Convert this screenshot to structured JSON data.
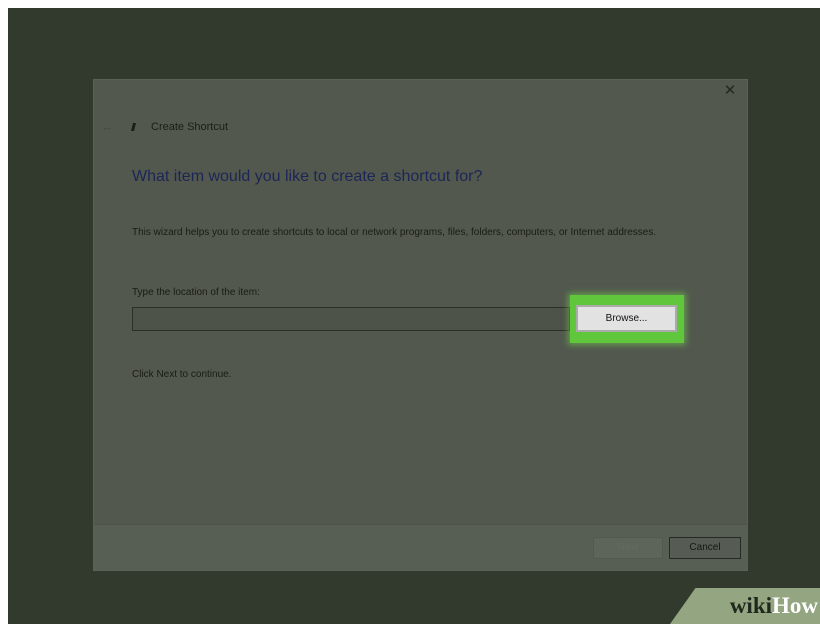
{
  "window": {
    "title": "Create Shortcut",
    "close_symbol": "✕",
    "back_symbol": "←"
  },
  "content": {
    "heading": "What item would you like to create a shortcut for?",
    "description": "This wizard helps you to create shortcuts to local or network programs, files, folders, computers, or Internet addresses.",
    "location_label": "Type the location of the item:",
    "location_value": "",
    "browse_label": "Browse...",
    "continue_text": "Click Next to continue."
  },
  "footer": {
    "next_label": "Next",
    "cancel_label": "Cancel"
  },
  "watermark": {
    "wiki": "wiki",
    "how": "How"
  },
  "colors": {
    "highlight": "#60c63b",
    "heading": "#1c2655",
    "overlay_background": "#323a2d"
  },
  "icons": {
    "close": "close-icon",
    "back": "back-arrow-icon",
    "wizard": "shortcut-wizard-icon"
  }
}
